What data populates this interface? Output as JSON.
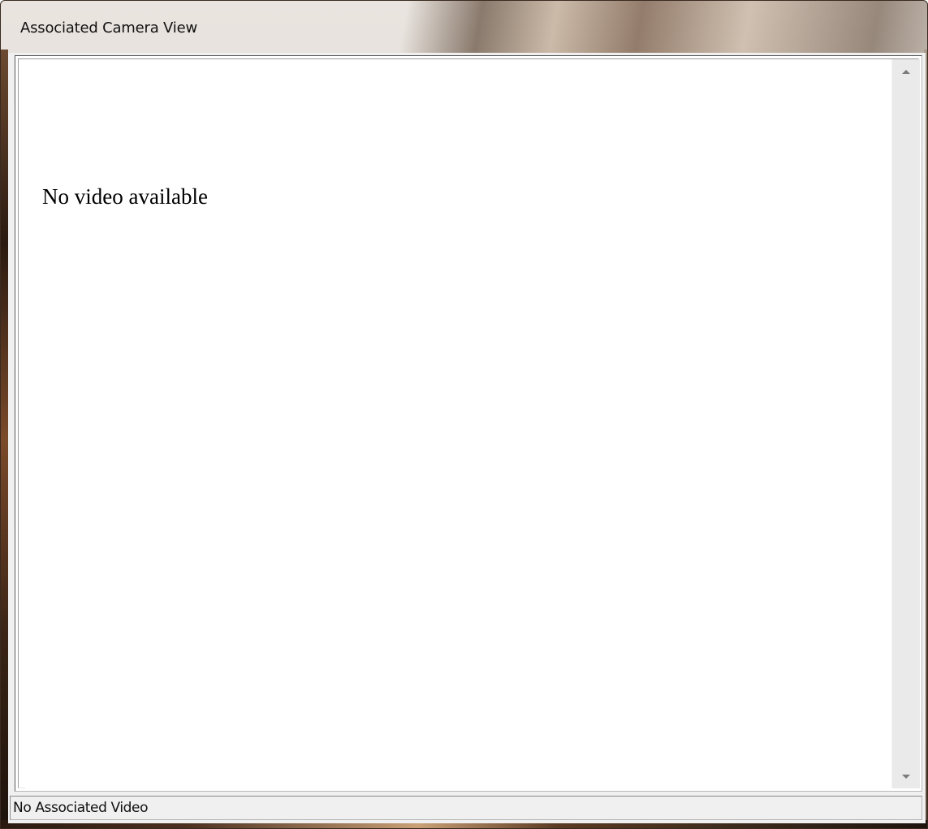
{
  "window": {
    "title": "Associated Camera View"
  },
  "content": {
    "message": "No video available"
  },
  "scrollbar": {
    "up_icon": "arrow-up-icon",
    "down_icon": "arrow-down-icon"
  },
  "status_bar": {
    "text": "No Associated Video"
  }
}
